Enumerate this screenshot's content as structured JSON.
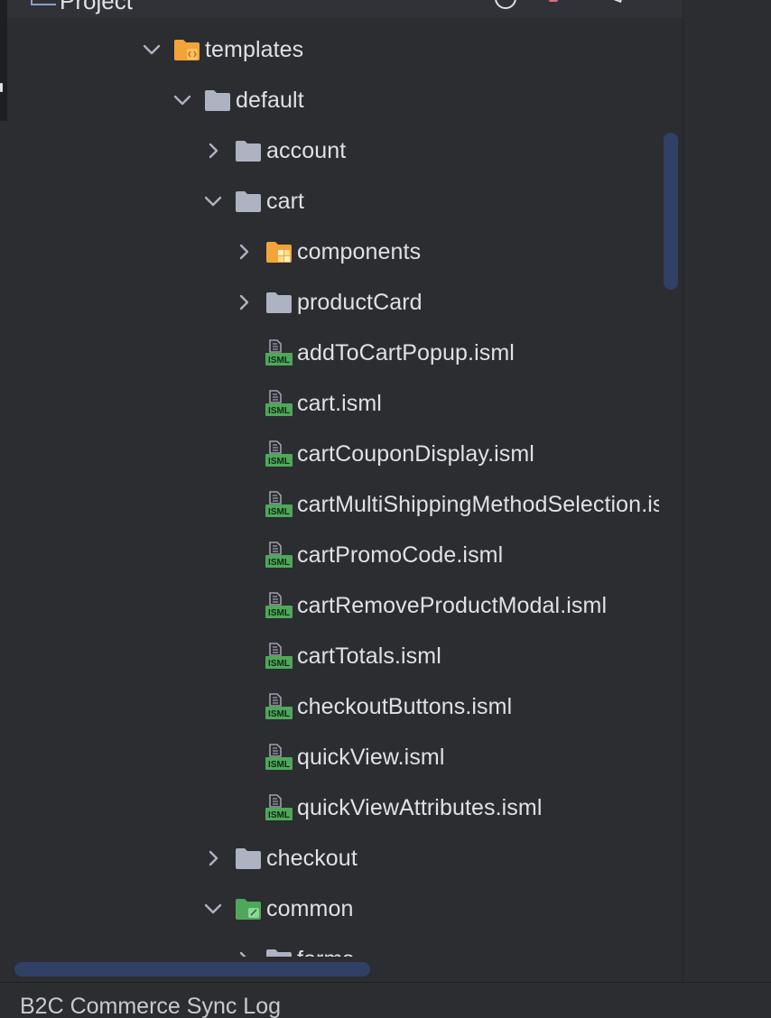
{
  "header": {
    "title": "Project"
  },
  "tree": [
    {
      "label": "templates",
      "expanded": true,
      "icon": "folder-templates-icon"
    },
    {
      "label": "default",
      "expanded": true,
      "icon": "folder-icon"
    },
    {
      "label": "account",
      "expanded": false,
      "icon": "folder-icon"
    },
    {
      "label": "cart",
      "expanded": true,
      "icon": "folder-icon"
    },
    {
      "label": "components",
      "expanded": false,
      "icon": "folder-components-icon"
    },
    {
      "label": "productCard",
      "expanded": false,
      "icon": "folder-icon"
    },
    {
      "label": "addToCartPopup.isml",
      "icon": "isml-file-icon"
    },
    {
      "label": "cart.isml",
      "icon": "isml-file-icon"
    },
    {
      "label": "cartCouponDisplay.isml",
      "icon": "isml-file-icon"
    },
    {
      "label": "cartMultiShippingMethodSelection.isml",
      "icon": "isml-file-icon"
    },
    {
      "label": "cartPromoCode.isml",
      "icon": "isml-file-icon"
    },
    {
      "label": "cartRemoveProductModal.isml",
      "icon": "isml-file-icon"
    },
    {
      "label": "cartTotals.isml",
      "icon": "isml-file-icon"
    },
    {
      "label": "checkoutButtons.isml",
      "icon": "isml-file-icon"
    },
    {
      "label": "quickView.isml",
      "icon": "isml-file-icon"
    },
    {
      "label": "quickViewAttributes.isml",
      "icon": "isml-file-icon"
    },
    {
      "label": "checkout",
      "expanded": false,
      "icon": "folder-icon"
    },
    {
      "label": "common",
      "expanded": true,
      "icon": "folder-resource-icon"
    },
    {
      "label": "forms",
      "expanded": false,
      "icon": "folder-icon"
    }
  ],
  "bottom_panel": {
    "title": "B2C Commerce Sync Log"
  },
  "colors": {
    "background": "#2b2d30",
    "text": "#dfe1e5",
    "folder": "#aeb3c2",
    "folder_accent": "#f2a33a",
    "isml_green": "#4fa85a",
    "scrollbar": "#2f4166"
  }
}
